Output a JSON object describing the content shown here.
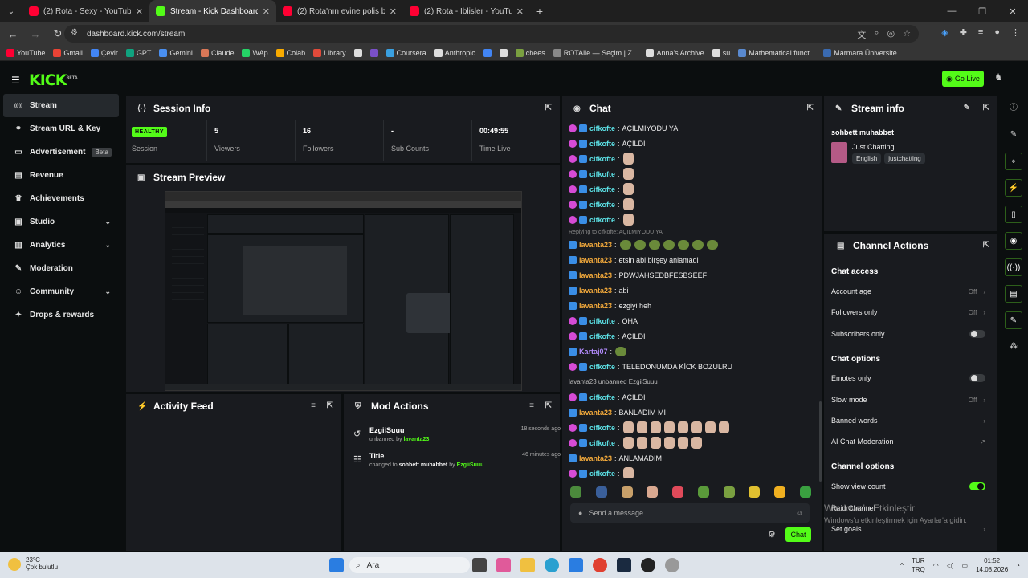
{
  "browser": {
    "tabs": [
      {
        "title": "(2) Rota - Sexy - YouTube",
        "color": "#ff0033",
        "active": false
      },
      {
        "title": "Stream - Kick Dashboard",
        "color": "#53fc18",
        "active": true
      },
      {
        "title": "(2) Rota'nın evine polis baskını",
        "color": "#ff0033",
        "active": false
      },
      {
        "title": "(2) Rota - İblisler - YouTube",
        "color": "#ff0033",
        "active": false
      }
    ],
    "url": "dashboard.kick.com/stream",
    "bookmarks": [
      "YouTube",
      "Gmail",
      "Çevir",
      "GPT",
      "Gemini",
      "Claude",
      "WAp",
      "Colab",
      "Library",
      "",
      "",
      "Coursera",
      "Anthropic",
      "",
      "",
      "chees",
      "ROTAile — Seçim | Z...",
      "Anna's Archive",
      "su",
      "Mathematical funct...",
      "Marmara Üniversite..."
    ]
  },
  "header": {
    "logo": "KICK",
    "logo_sup": "BETA",
    "go_live": "Go Live"
  },
  "sidebar": {
    "items": [
      {
        "label": "Stream",
        "icon": "broadcast-icon",
        "glyph": "((·))",
        "active": true
      },
      {
        "label": "Stream URL & Key",
        "icon": "link-icon",
        "glyph": "⚭"
      },
      {
        "label": "Advertisement",
        "icon": "tv-icon",
        "glyph": "▭",
        "badge": "Beta"
      },
      {
        "label": "Revenue",
        "icon": "chart-icon",
        "glyph": "▤"
      },
      {
        "label": "Achievements",
        "icon": "trophy-icon",
        "glyph": "♛"
      },
      {
        "label": "Studio",
        "icon": "studio-icon",
        "glyph": "▣",
        "chevron": true
      },
      {
        "label": "Analytics",
        "icon": "analytics-icon",
        "glyph": "▥",
        "chevron": true
      },
      {
        "label": "Moderation",
        "icon": "wrench-icon",
        "glyph": "✎"
      },
      {
        "label": "Community",
        "icon": "community-icon",
        "glyph": "☺",
        "chevron": true
      },
      {
        "label": "Drops & rewards",
        "icon": "gift-icon",
        "glyph": "✦"
      }
    ]
  },
  "session": {
    "title": "Session Info",
    "health": "HEALTHY",
    "session_label": "Session",
    "stats": [
      {
        "value": "5",
        "label": "Viewers"
      },
      {
        "value": "16",
        "label": "Followers"
      },
      {
        "value": "-",
        "label": "Sub Counts"
      },
      {
        "value": "00:49:55",
        "label": "Time Live"
      }
    ]
  },
  "preview": {
    "title": "Stream Preview"
  },
  "activity": {
    "title": "Activity Feed"
  },
  "mod_actions": {
    "title": "Mod Actions",
    "items": [
      {
        "name": "EzgiiSuuu",
        "text": "unbanned by ",
        "by": "lavanta23",
        "time": "18 seconds ago"
      },
      {
        "name": "Title",
        "text": "changed to ",
        "value": "sohbett muhabbet",
        "by_text": " by ",
        "by": "EzgiiSuuu",
        "time": "46 minutes ago"
      }
    ]
  },
  "chat": {
    "title": "Chat",
    "messages": [
      {
        "user": "cifkofte",
        "color": "#5ce1e6",
        "text": "AÇILMIYODU YA",
        "b": 2
      },
      {
        "user": "cifkofte",
        "color": "#5ce1e6",
        "text": "AÇILDI",
        "b": 2
      },
      {
        "user": "cifkofte",
        "color": "#5ce1e6",
        "text": "",
        "emotes": 1,
        "b": 2
      },
      {
        "user": "cifkofte",
        "color": "#5ce1e6",
        "text": "",
        "emotes": 1,
        "b": 2
      },
      {
        "user": "cifkofte",
        "color": "#5ce1e6",
        "text": "",
        "emotes": 1,
        "b": 2
      },
      {
        "user": "cifkofte",
        "color": "#5ce1e6",
        "text": "",
        "emotes": 1,
        "b": 2
      },
      {
        "user": "cifkofte",
        "color": "#5ce1e6",
        "text": "",
        "emotes": 1,
        "b": 2
      },
      {
        "reply": "Replying to cifkofte: AÇILMIYODU YA"
      },
      {
        "user": "lavanta23",
        "color": "#f2a93b",
        "text": "",
        "emotes2": 7,
        "b": 1
      },
      {
        "user": "lavanta23",
        "color": "#f2a93b",
        "text": "etsin abi birşey anlamadi",
        "b": 1
      },
      {
        "user": "lavanta23",
        "color": "#f2a93b",
        "text": "PDWJAHSEDBFESBSEEF",
        "b": 1
      },
      {
        "user": "lavanta23",
        "color": "#f2a93b",
        "text": "abi",
        "b": 1
      },
      {
        "user": "lavanta23",
        "color": "#f2a93b",
        "text": "ezgiyi heh",
        "b": 1
      },
      {
        "user": "cifkofte",
        "color": "#5ce1e6",
        "text": "OHA",
        "b": 2
      },
      {
        "user": "cifkofte",
        "color": "#5ce1e6",
        "text": "AÇILDI",
        "b": 2
      },
      {
        "user": "Kartaj07",
        "color": "#b48cff",
        "text": "",
        "emotes2": 1,
        "b": 1
      },
      {
        "user": "cifkofte",
        "color": "#5ce1e6",
        "text": "TELEDONUMDA KİCK BOZULRU",
        "b": 2
      },
      {
        "sys": "lavanta23 unbanned EzgiiSuuu"
      },
      {
        "user": "cifkofte",
        "color": "#5ce1e6",
        "text": "AÇILDI",
        "b": 2
      },
      {
        "user": "lavanta23",
        "color": "#f2a93b",
        "text": "BANLADİM Mİ",
        "b": 1
      },
      {
        "user": "cifkofte",
        "color": "#5ce1e6",
        "text": "",
        "emotes": 8,
        "b": 2
      },
      {
        "user": "cifkofte",
        "color": "#5ce1e6",
        "text": "",
        "emotes": 6,
        "b": 2
      },
      {
        "user": "lavanta23",
        "color": "#f2a93b",
        "text": "ANLAMADIM",
        "b": 1
      },
      {
        "user": "cifkofte",
        "color": "#5ce1e6",
        "text": "",
        "emotes": 1,
        "b": 2
      }
    ],
    "emote_colors": [
      "#4b8a3c",
      "#3a5f9a",
      "#c8a06a",
      "#d9a890",
      "#e04a5a",
      "#5a9a3a",
      "#7aa040",
      "#e0c030",
      "#f0b020",
      "#3aa040"
    ],
    "placeholder": "Send a message",
    "send": "Chat"
  },
  "stream_info": {
    "title": "Stream info",
    "stream_title": "sohbett muhabbet",
    "category": "Just Chatting",
    "tags": [
      "English",
      "justchatting"
    ]
  },
  "channel_actions": {
    "title": "Channel Actions",
    "chat_access": "Chat access",
    "account_age": "Account age",
    "account_age_val": "Off",
    "followers_only": "Followers only",
    "followers_only_val": "Off",
    "subscribers_only": "Subscribers only",
    "chat_options": "Chat options",
    "emotes_only": "Emotes only",
    "slow_mode": "Slow mode",
    "slow_mode_val": "Off",
    "banned_words": "Banned words",
    "ai_moderation": "AI Chat Moderation",
    "channel_options": "Channel options",
    "show_view_count": "Show view count",
    "raid_channel": "Raid Channel",
    "set_goals": "Set goals"
  },
  "windows": {
    "watermark1": "Windows'u Etkinleştir",
    "watermark2": "Windows'u etkinleştirmek için Ayarlar'a gidin.",
    "weather_temp": "23°C",
    "weather_text": "Çok bulutlu",
    "search": "Ara",
    "lang1": "TUR",
    "lang2": "TRQ",
    "time": "01:52",
    "date": "14.08.2026"
  }
}
